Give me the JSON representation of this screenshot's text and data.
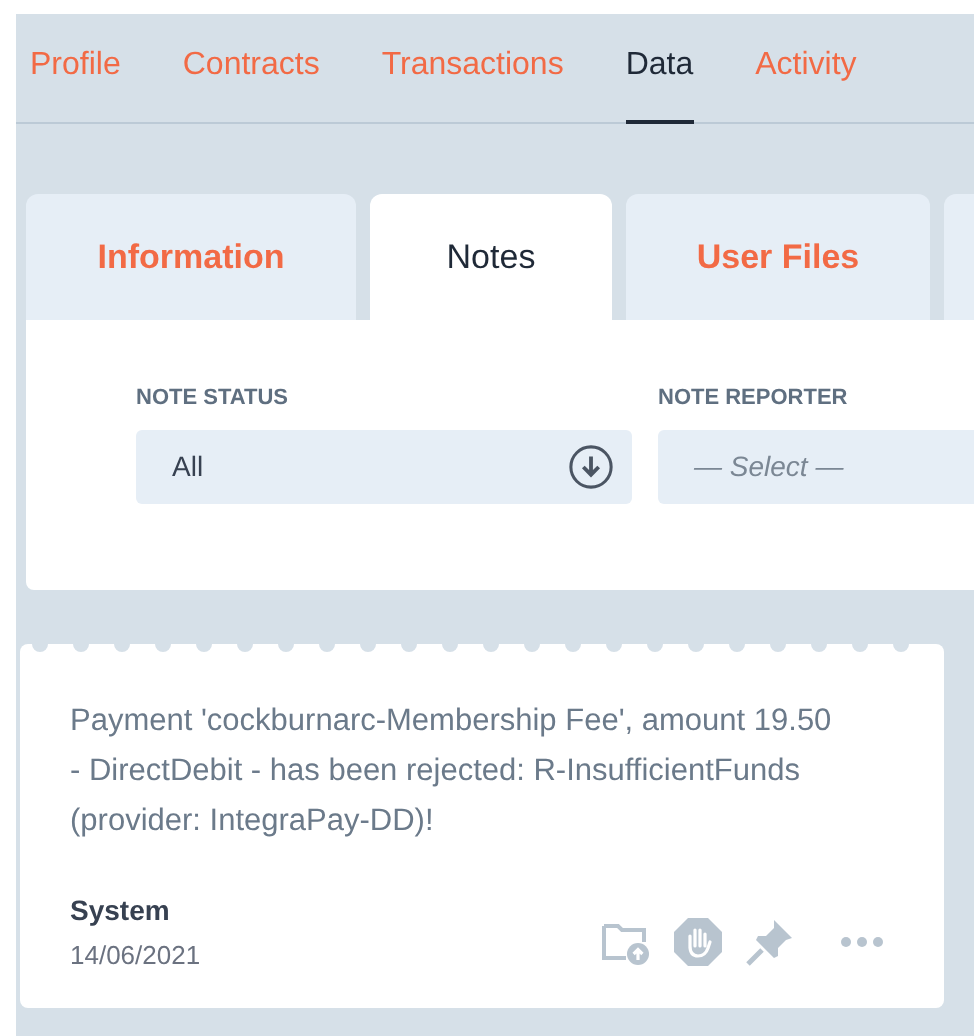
{
  "main_tabs": [
    {
      "label": "Profile",
      "selected": false
    },
    {
      "label": "Contracts",
      "selected": false
    },
    {
      "label": "Transactions",
      "selected": false
    },
    {
      "label": "Data",
      "selected": true
    },
    {
      "label": "Activity",
      "selected": false
    }
  ],
  "sub_tabs": [
    {
      "label": "Information",
      "selected": false
    },
    {
      "label": "Notes",
      "selected": true
    },
    {
      "label": "User Files",
      "selected": false
    }
  ],
  "filters": [
    {
      "label": "NOTE STATUS",
      "value": "All"
    },
    {
      "label": "NOTE REPORTER",
      "placeholder": "— Select —"
    }
  ],
  "notes": [
    {
      "text": "Payment 'cockburnarc-Membership Fee', amount 19.50 - DirectDebit - has been rejected: R-InsufficientFunds (provider: IntegraPay-DD)!",
      "author": "System",
      "date": "14/06/2021"
    }
  ]
}
